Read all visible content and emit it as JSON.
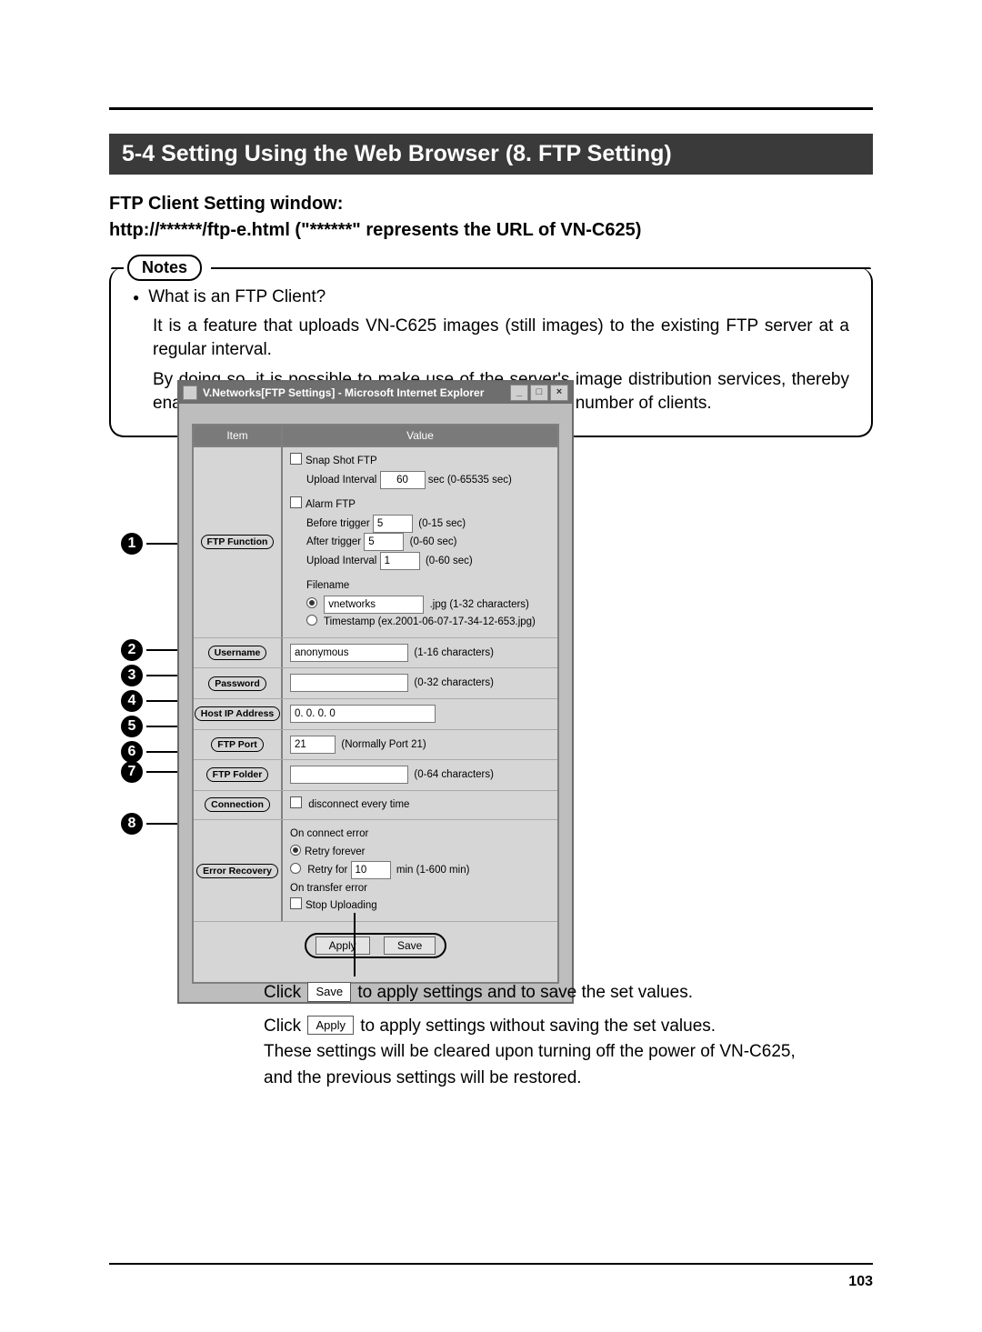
{
  "section_title": "5-4 Setting Using the Web Browser (8. FTP Setting)",
  "subhead_line1": "FTP Client Setting window:",
  "subhead_line2": "http://******/ftp-e.html (\"******\" represents the URL of VN-C625)",
  "notes_label": "Notes",
  "notes": {
    "q": "What is an FTP Client?",
    "p1": "It is a feature that uploads VN-C625 images (still images) to the existing FTP server at a regular interval.",
    "p2": "By doing so, it is possible to make use of the server's image distribution services, thereby enabling distribution of images to a considerably larger number of clients."
  },
  "window": {
    "title": "V.Networks[FTP Settings] - Microsoft Internet Explorer",
    "header_item": "Item",
    "header_value": "Value",
    "rows": {
      "ftp_function": {
        "label": "FTP Function",
        "snapshot_label": "Snap Shot FTP",
        "upload_interval_label": "Upload Interval",
        "upload_interval_value": "60",
        "upload_interval_hint": "sec (0-65535 sec)",
        "alarm_label": "Alarm FTP",
        "before_label": "Before trigger",
        "before_value": "5",
        "before_hint": "(0-15 sec)",
        "after_label": "After  trigger",
        "after_value": "5",
        "after_hint": "(0-60 sec)",
        "alarm_upload_interval_label": "Upload Interval",
        "alarm_upload_interval_value": "1",
        "alarm_upload_interval_hint": "(0-60 sec)",
        "filename_label": "Filename",
        "filename_value": "vnetworks",
        "filename_hint": ".jpg (1-32 characters)",
        "timestamp_label": "Timestamp (ex.2001-06-07-17-34-12-653.jpg)"
      },
      "username": {
        "label": "Username",
        "value": "anonymous",
        "hint": "(1-16 characters)"
      },
      "password": {
        "label": "Password",
        "value": "",
        "hint": "(0-32 characters)"
      },
      "host_ip": {
        "label": "Host IP Address",
        "value": "0. 0. 0. 0"
      },
      "ftp_port": {
        "label": "FTP Port",
        "value": "21",
        "hint": "(Normally Port 21)"
      },
      "ftp_folder": {
        "label": "FTP Folder",
        "value": "",
        "hint": "(0-64 characters)"
      },
      "connection": {
        "label": "Connection",
        "check_label": "disconnect every time"
      },
      "error_recovery": {
        "label": "Error Recovery",
        "on_connect": "On connect error",
        "retry_forever": "Retry forever",
        "retry_for_label": "Retry for",
        "retry_for_value": "10",
        "retry_for_hint": "min (1-600 min)",
        "on_transfer": "On transfer error",
        "stop_uploading": "Stop Uploading"
      }
    },
    "apply_btn": "Apply",
    "save_btn": "Save"
  },
  "callouts": [
    "1",
    "2",
    "3",
    "4",
    "5",
    "6",
    "7",
    "8"
  ],
  "explain": {
    "click": "Click",
    "save_btn": "Save",
    "save_txt": " to apply settings and to save the set values.",
    "apply_btn": "Apply",
    "apply_txt": " to apply settings without saving the set values.",
    "note1": "These settings will be cleared upon turning off the power of VN-C625,",
    "note2": "and the previous settings will be restored."
  },
  "page_number": "103"
}
